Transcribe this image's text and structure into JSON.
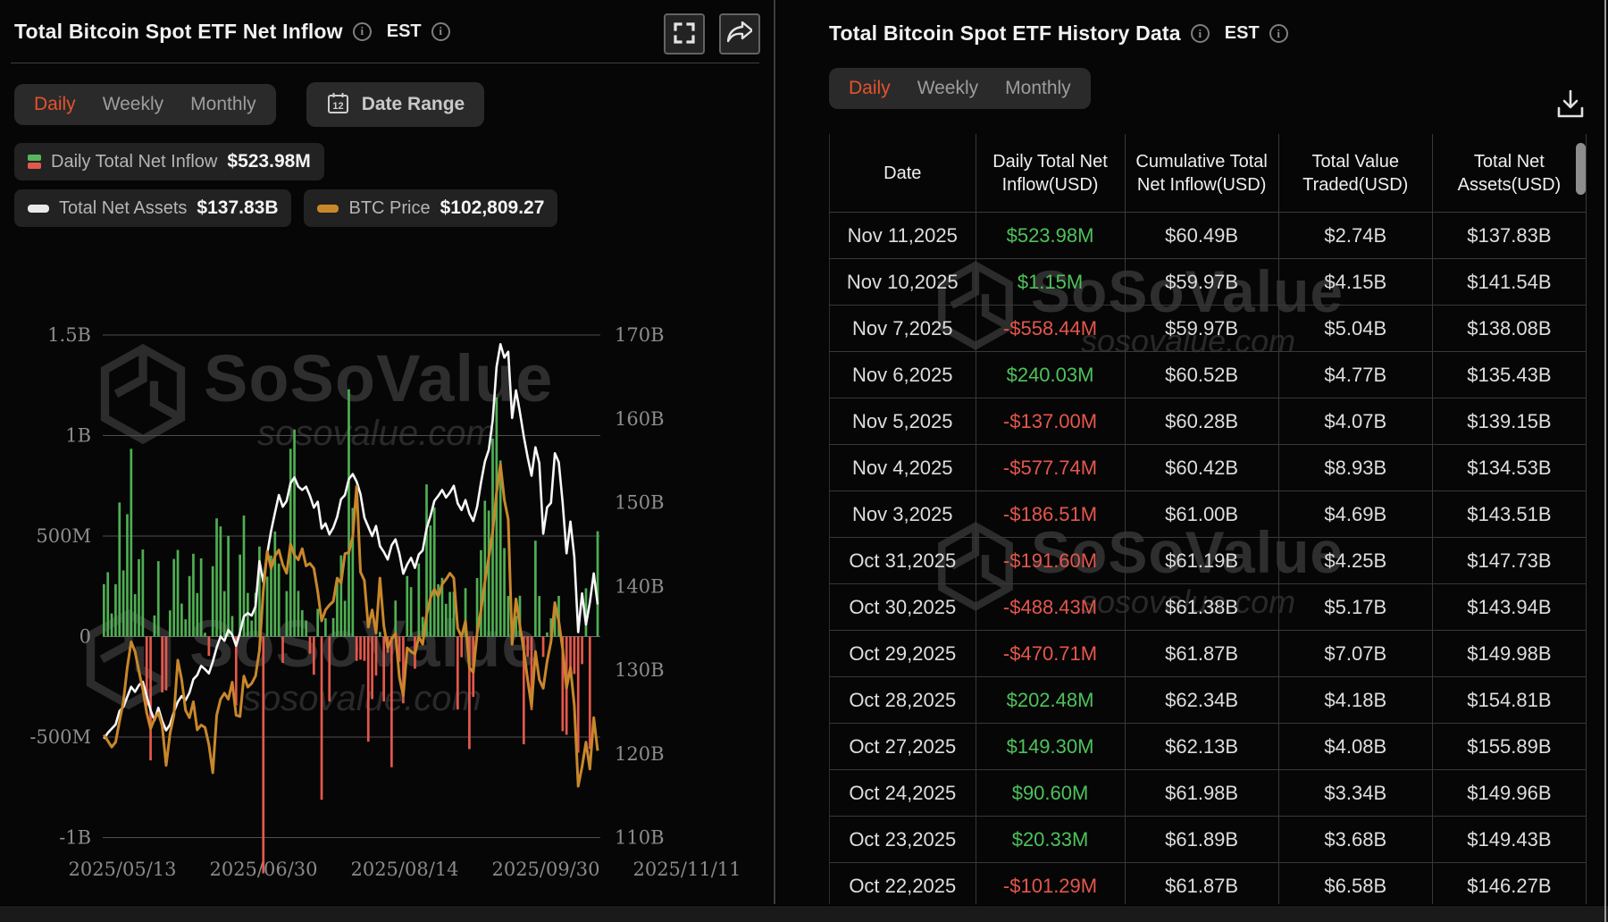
{
  "watermark": {
    "brand": "SoSoValue",
    "domain": "sosovalue.com"
  },
  "left_panel": {
    "title": "Total Bitcoin Spot ETF Net Inflow",
    "est_label": "EST",
    "tabs": [
      "Daily",
      "Weekly",
      "Monthly"
    ],
    "active_tab": "Daily",
    "date_range_label": "Date Range",
    "calendar_day": "12",
    "legend": [
      {
        "label": "Daily Total Net Inflow",
        "value": "$523.98M"
      },
      {
        "label": "Total Net Assets",
        "value": "$137.83B"
      },
      {
        "label": "BTC Price",
        "value": "$102,809.27"
      }
    ]
  },
  "right_panel": {
    "title": "Total Bitcoin Spot ETF History Data",
    "est_label": "EST",
    "tabs": [
      "Daily",
      "Weekly",
      "Monthly"
    ],
    "active_tab": "Daily",
    "table": {
      "columns": [
        "Date",
        "Daily Total Net Inflow(USD)",
        "Cumulative Total Net Inflow(USD)",
        "Total Value Traded(USD)",
        "Total Net Assets(USD)"
      ],
      "rows": [
        {
          "date": "Nov 11,2025",
          "inflow": "$523.98M",
          "positive": true,
          "cumulative": "$60.49B",
          "traded": "$2.74B",
          "assets": "$137.83B"
        },
        {
          "date": "Nov 10,2025",
          "inflow": "$1.15M",
          "positive": true,
          "cumulative": "$59.97B",
          "traded": "$4.15B",
          "assets": "$141.54B"
        },
        {
          "date": "Nov 7,2025",
          "inflow": "-$558.44M",
          "positive": false,
          "cumulative": "$59.97B",
          "traded": "$5.04B",
          "assets": "$138.08B"
        },
        {
          "date": "Nov 6,2025",
          "inflow": "$240.03M",
          "positive": true,
          "cumulative": "$60.52B",
          "traded": "$4.77B",
          "assets": "$135.43B"
        },
        {
          "date": "Nov 5,2025",
          "inflow": "-$137.00M",
          "positive": false,
          "cumulative": "$60.28B",
          "traded": "$4.07B",
          "assets": "$139.15B"
        },
        {
          "date": "Nov 4,2025",
          "inflow": "-$577.74M",
          "positive": false,
          "cumulative": "$60.42B",
          "traded": "$8.93B",
          "assets": "$134.53B"
        },
        {
          "date": "Nov 3,2025",
          "inflow": "-$186.51M",
          "positive": false,
          "cumulative": "$61.00B",
          "traded": "$4.69B",
          "assets": "$143.51B"
        },
        {
          "date": "Oct 31,2025",
          "inflow": "-$191.60M",
          "positive": false,
          "cumulative": "$61.19B",
          "traded": "$4.25B",
          "assets": "$147.73B"
        },
        {
          "date": "Oct 30,2025",
          "inflow": "-$488.43M",
          "positive": false,
          "cumulative": "$61.38B",
          "traded": "$5.17B",
          "assets": "$143.94B"
        },
        {
          "date": "Oct 29,2025",
          "inflow": "-$470.71M",
          "positive": false,
          "cumulative": "$61.87B",
          "traded": "$7.07B",
          "assets": "$149.98B"
        },
        {
          "date": "Oct 28,2025",
          "inflow": "$202.48M",
          "positive": true,
          "cumulative": "$62.34B",
          "traded": "$4.18B",
          "assets": "$154.81B"
        },
        {
          "date": "Oct 27,2025",
          "inflow": "$149.30M",
          "positive": true,
          "cumulative": "$62.13B",
          "traded": "$4.08B",
          "assets": "$155.89B"
        },
        {
          "date": "Oct 24,2025",
          "inflow": "$90.60M",
          "positive": true,
          "cumulative": "$61.98B",
          "traded": "$3.34B",
          "assets": "$149.96B"
        },
        {
          "date": "Oct 23,2025",
          "inflow": "$20.33M",
          "positive": true,
          "cumulative": "$61.89B",
          "traded": "$3.68B",
          "assets": "$149.43B"
        },
        {
          "date": "Oct 22,2025",
          "inflow": "-$101.29M",
          "positive": false,
          "cumulative": "$61.87B",
          "traded": "$6.58B",
          "assets": "$146.27B"
        }
      ]
    }
  },
  "chart_data": {
    "type": "combo",
    "x_start": "2025/05/13",
    "x_end": "2025/11/11",
    "x_ticks": [
      "2025/05/13",
      "2025/06/30",
      "2025/08/14",
      "2025/09/30",
      "2025/11/11"
    ],
    "left_ticks": [
      "1.5B",
      "1B",
      "500M",
      "0",
      "-500M",
      "-1B"
    ],
    "right_ticks": [
      "170B",
      "160B",
      "150B",
      "140B",
      "130B",
      "120B",
      "110B"
    ],
    "ylim_left_millions": [
      -1000,
      1500
    ],
    "ylim_right_billions": [
      110,
      170
    ],
    "bars_name": "Daily Total Net Inflow (USD millions)",
    "bars": [
      261,
      320,
      115,
      260,
      667,
      329,
      609,
      934,
      211,
      385,
      433,
      -346,
      -616,
      105,
      375,
      -278,
      -268,
      130,
      386,
      431,
      164,
      86,
      301,
      412,
      216,
      389,
      19,
      -96,
      350,
      588,
      548,
      226,
      501,
      102,
      -342,
      408,
      602,
      217,
      80,
      218,
      448,
      -1178,
      298,
      403,
      523,
      363,
      -131,
      226,
      934,
      1030,
      227,
      131,
      80,
      -85,
      -190,
      138,
      -812,
      91,
      -323,
      92,
      277,
      404,
      178,
      1230,
      640,
      -121,
      -115,
      -121,
      -523,
      -311,
      -194,
      23,
      -323,
      -80,
      -650,
      179,
      -126,
      -332,
      301,
      246,
      -160,
      364,
      98,
      757,
      553,
      642,
      260,
      292,
      163,
      222,
      223,
      -363,
      -103,
      241,
      -560,
      -300,
      291,
      430,
      676,
      627,
      985,
      1190,
      876,
      440,
      202,
      -5,
      103,
      203,
      -536,
      -101,
      -366,
      477,
      202,
      -101.29,
      20.33,
      90.6,
      149.3,
      202.48,
      -470.71,
      -488.43,
      -191.6,
      -186.51,
      -577.74,
      -137,
      240.03,
      -558.44,
      1.15,
      523.98
    ],
    "series": [
      {
        "name": "Total Net Assets (USD billions)",
        "axis": "right",
        "values": [
          121.8,
          122.5,
          123,
          123.5,
          125.1,
          125.6,
          126.8,
          128,
          127.4,
          128.2,
          128.6,
          126.9,
          125.2,
          124,
          125.5,
          123.9,
          122.8,
          123.5,
          125,
          126.2,
          126.9,
          126.4,
          127.3,
          128.9,
          129.4,
          130.5,
          130.1,
          129.6,
          131,
          132.7,
          134,
          133.5,
          134.8,
          134.2,
          132.9,
          134.5,
          136.4,
          136.8,
          136.5,
          137.6,
          143,
          140.5,
          143.9,
          146.6,
          148.8,
          150.9,
          149.5,
          150.2,
          152.3,
          153,
          151.9,
          151.5,
          151.9,
          150.8,
          149.4,
          150.1,
          146.9,
          147.5,
          146.2,
          147,
          148.3,
          150.4,
          150.9,
          152.8,
          153.4,
          152.5,
          151,
          148.2,
          147.1,
          146,
          147.2,
          144.8,
          144.1,
          143.2,
          144.9,
          145.6,
          143.9,
          141.5,
          142.6,
          143.4,
          142.2,
          143.8,
          144.3,
          146.9,
          148.4,
          150.2,
          150.8,
          151.5,
          150.6,
          151.2,
          152,
          149.9,
          149.1,
          150.3,
          148.7,
          147.8,
          149.5,
          152.4,
          154.9,
          156.3,
          159.8,
          166.2,
          168.9,
          167.3,
          168,
          160.1,
          163.4,
          160.8,
          157.9,
          155.4,
          153.2,
          156.6,
          154.7,
          146.27,
          149.43,
          149.96,
          155.89,
          154.81,
          149.98,
          143.94,
          147.73,
          143.51,
          134.53,
          139.15,
          135.43,
          138.08,
          141.54,
          137.83
        ]
      },
      {
        "name": "BTC Price (USD thousands)",
        "axis": "hidden",
        "values": [
          104.1,
          103.6,
          103.1,
          103.5,
          105.2,
          106.8,
          109.6,
          111.7,
          110.9,
          109.3,
          107.8,
          105.9,
          104.6,
          105.4,
          105.9,
          104.8,
          101.6,
          104.2,
          105.7,
          110.2,
          108.6,
          106.1,
          105.5,
          106.8,
          104.5,
          104.9,
          104.7,
          103.3,
          101,
          105.7,
          107,
          107.5,
          107,
          108.4,
          105.7,
          105.6,
          108.9,
          108,
          108.3,
          108.9,
          111,
          115.9,
          119.1,
          117.7,
          118.7,
          119.2,
          118,
          117.3,
          119.7,
          118.8,
          118.4,
          119.3,
          117.9,
          118.1,
          117.7,
          115.8,
          113.4,
          114.3,
          114.7,
          115,
          116.9,
          116.5,
          118.9,
          119,
          120.3,
          124.4,
          117.4,
          116.7,
          112.9,
          114.3,
          112.4,
          116.9,
          113,
          111.2,
          111.9,
          112.4,
          108.8,
          107.3,
          111.2,
          110.9,
          110.7,
          112.1,
          111.5,
          113.9,
          115.3,
          116,
          115.4,
          116.4,
          116.8,
          117.3,
          116.9,
          112.8,
          112.1,
          113.4,
          109.6,
          109.2,
          112.4,
          114.3,
          116.6,
          118.6,
          120.7,
          123.9,
          126.2,
          123.3,
          121.7,
          111.5,
          115.2,
          113,
          111,
          108.6,
          106.4,
          110.9,
          108.6,
          107.9,
          110.1,
          111.7,
          114.9,
          113.4,
          111.1,
          107.9,
          109.6,
          106.5,
          99.9,
          101.5,
          103.5,
          101.3,
          105.5,
          102.8
        ]
      }
    ],
    "colors": {
      "positive": "#4fae52",
      "negative": "#e4584b",
      "assets": "#f7f7f7",
      "btc": "#c9872b"
    },
    "grid": true,
    "legend_position": "top-left"
  }
}
